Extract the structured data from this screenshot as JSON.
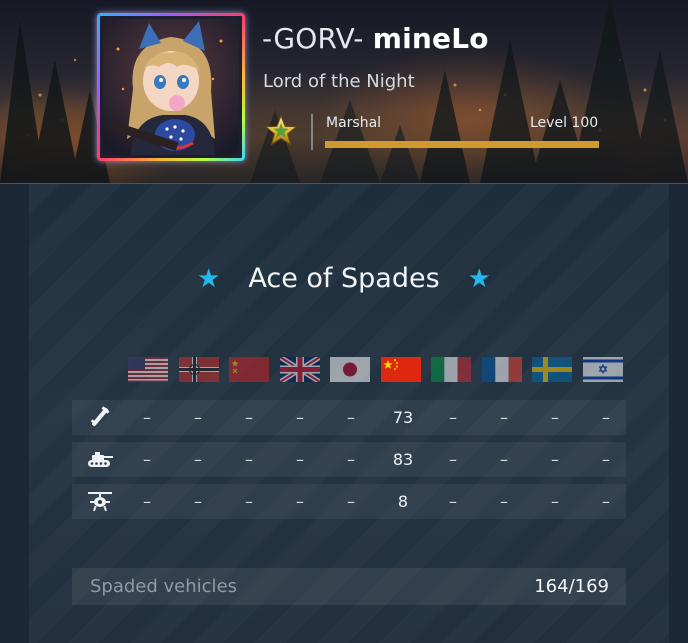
{
  "profile": {
    "clan_tag": "-GORV-",
    "nickname": "mineLo",
    "title": "Lord of the Night",
    "rank_name": "Marshal",
    "level_label": "Level 100",
    "level_progress": 1.0
  },
  "achievement": {
    "title": "Ace of Spades",
    "star_icon": "star-icon",
    "star_color": "#22b8ee"
  },
  "nations": [
    {
      "name": "usa",
      "active": false
    },
    {
      "name": "germany",
      "active": false
    },
    {
      "name": "ussr",
      "active": false
    },
    {
      "name": "britain",
      "active": false
    },
    {
      "name": "japan",
      "active": false
    },
    {
      "name": "china",
      "active": true
    },
    {
      "name": "italy",
      "active": false
    },
    {
      "name": "france",
      "active": false
    },
    {
      "name": "sweden",
      "active": false
    },
    {
      "name": "israel",
      "active": false
    }
  ],
  "rows": [
    {
      "icon": "aircraft-icon",
      "values": [
        "–",
        "–",
        "–",
        "–",
        "–",
        "73",
        "–",
        "–",
        "–",
        "–"
      ]
    },
    {
      "icon": "tank-icon",
      "values": [
        "–",
        "–",
        "–",
        "–",
        "–",
        "83",
        "–",
        "–",
        "–",
        "–"
      ]
    },
    {
      "icon": "helicopter-icon",
      "values": [
        "–",
        "–",
        "–",
        "–",
        "–",
        "8",
        "–",
        "–",
        "–",
        "–"
      ]
    }
  ],
  "footer": {
    "label": "Spaded vehicles",
    "value": "164/169"
  },
  "colors": {
    "accent_star": "#22b8ee",
    "level_bar": "#d19a2e"
  }
}
